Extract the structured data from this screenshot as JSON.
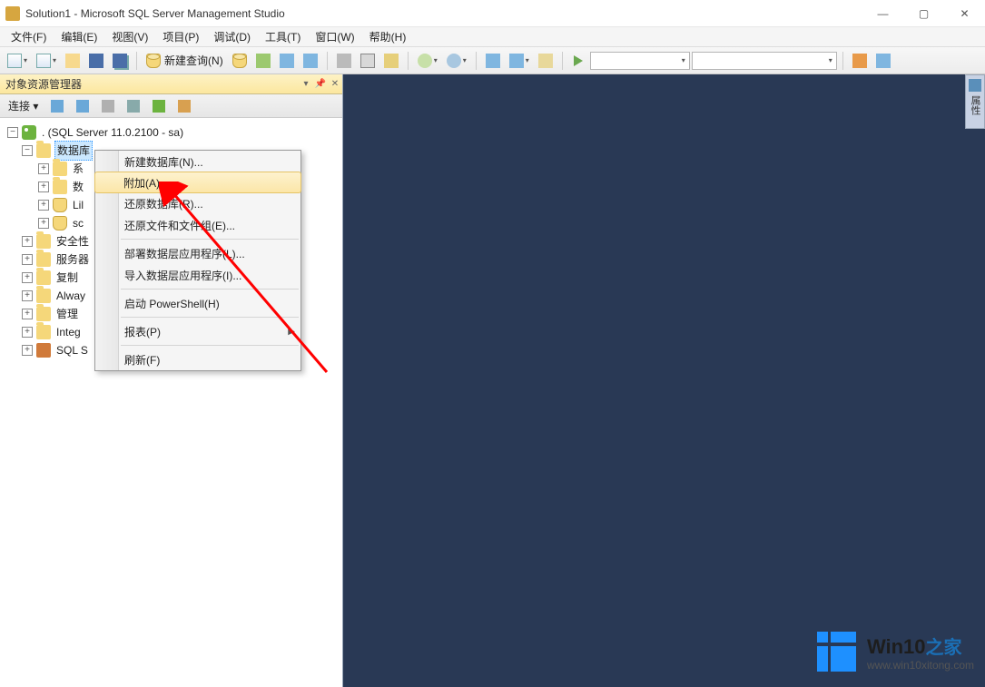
{
  "window": {
    "title": "Solution1 - Microsoft SQL Server Management Studio",
    "min": "—",
    "max": "▢",
    "close": "✕"
  },
  "menu": [
    "文件(F)",
    "编辑(E)",
    "视图(V)",
    "项目(P)",
    "调试(D)",
    "工具(T)",
    "窗口(W)",
    "帮助(H)"
  ],
  "toolbar": {
    "new_query": "新建查询(N)",
    "combo_placeholder": ""
  },
  "sidepanel": {
    "title": "对象资源管理器",
    "connect_label": "连接 ▾"
  },
  "tree": {
    "root": ". (SQL Server 11.0.2100 - sa)",
    "nodes": [
      {
        "label": "数据库",
        "selected": true
      },
      {
        "label": "系"
      },
      {
        "label": "数"
      },
      {
        "label": "Lil"
      },
      {
        "label": "sc"
      },
      {
        "label": "安全性"
      },
      {
        "label": "服务器"
      },
      {
        "label": "复制"
      },
      {
        "label": "Alway"
      },
      {
        "label": "管理"
      },
      {
        "label": "Integ"
      },
      {
        "label": "SQL S"
      }
    ]
  },
  "context_menu": {
    "items": [
      {
        "label": "新建数据库(N)..."
      },
      {
        "label": "附加(A)...",
        "hovered": true
      },
      {
        "label": "还原数据库(R)..."
      },
      {
        "label": "还原文件和文件组(E)..."
      },
      {
        "sep": true
      },
      {
        "label": "部署数据层应用程序(L)..."
      },
      {
        "label": "导入数据层应用程序(I)..."
      },
      {
        "sep": true
      },
      {
        "label": "启动 PowerShell(H)"
      },
      {
        "sep": true
      },
      {
        "label": "报表(P)",
        "submenu": true
      },
      {
        "sep": true
      },
      {
        "label": "刷新(F)"
      }
    ]
  },
  "right_strip": {
    "label": "属性"
  },
  "watermark": {
    "brand": "Win10",
    "suffix": "之家",
    "url": "www.win10xitong.com"
  }
}
